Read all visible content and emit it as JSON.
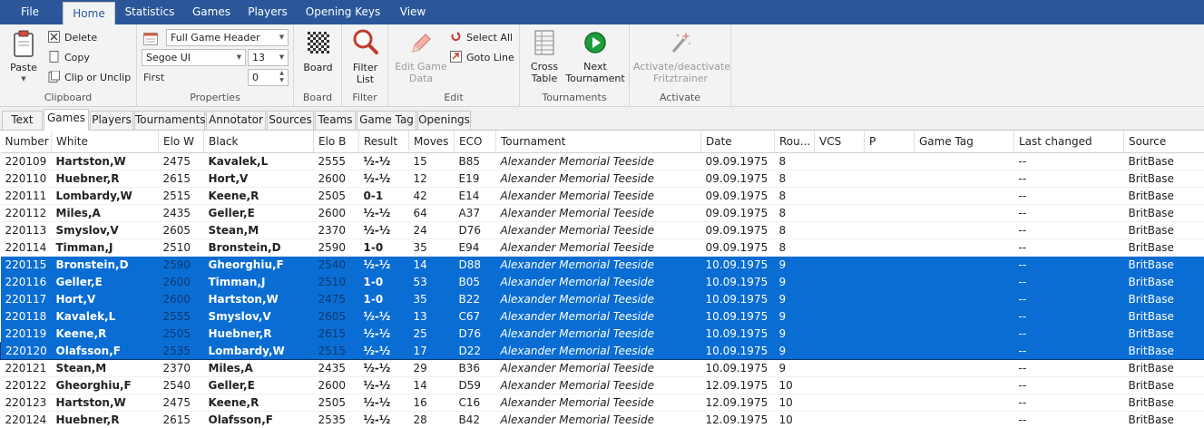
{
  "menu": {
    "file": "File",
    "home": "Home",
    "statistics": "Statistics",
    "games": "Games",
    "players": "Players",
    "opening_keys": "Opening Keys",
    "view": "View"
  },
  "ribbon": {
    "clipboard": {
      "label": "Clipboard",
      "paste": "Paste",
      "delete": "Delete",
      "copy": "Copy",
      "clip_or_unclip": "Clip or Unclip"
    },
    "properties": {
      "label": "Properties",
      "header_format": "Full Game Header",
      "font_family": "Segoe UI",
      "font_size": "13",
      "first_label": "First",
      "first_value": "0"
    },
    "board": {
      "label": "Board",
      "board_button": "Board"
    },
    "filter": {
      "label": "Filter",
      "filter_list_line1": "Filter",
      "filter_list_line2": "List"
    },
    "edit": {
      "label": "Edit",
      "edit_game_data_line1": "Edit Game",
      "edit_game_data_line2": "Data",
      "select_all": "Select All",
      "goto_line": "Goto Line"
    },
    "tournaments": {
      "label": "Tournaments",
      "cross_table_line1": "Cross",
      "cross_table_line2": "Table",
      "next_tournament_line1": "Next",
      "next_tournament_line2": "Tournament"
    },
    "activate": {
      "label": "Activate",
      "fritztrainer_line1": "Activate/deactivate",
      "fritztrainer_line2": "Fritztrainer"
    }
  },
  "tabs": [
    "Text",
    "Games",
    "Players",
    "Tournaments",
    "Annotator",
    "Sources",
    "Teams",
    "Game Tag",
    "Openings"
  ],
  "columns": [
    "Number",
    "White",
    "Elo W",
    "Black",
    "Elo B",
    "Result",
    "Moves",
    "ECO",
    "Tournament",
    "Date",
    "Rou...",
    "VCS",
    "P",
    "Game Tag",
    "Last changed",
    "Source"
  ],
  "rows": [
    [
      "220109",
      "Hartston,W",
      "2475",
      "Kavalek,L",
      "2555",
      "½-½",
      "15",
      "B85",
      "Alexander Memorial Teeside",
      "09.09.1975",
      "8",
      "",
      "",
      "",
      "--",
      "BritBase"
    ],
    [
      "220110",
      "Huebner,R",
      "2615",
      "Hort,V",
      "2600",
      "½-½",
      "12",
      "E19",
      "Alexander Memorial Teeside",
      "09.09.1975",
      "8",
      "",
      "",
      "",
      "--",
      "BritBase"
    ],
    [
      "220111",
      "Lombardy,W",
      "2515",
      "Keene,R",
      "2505",
      "0-1",
      "42",
      "E14",
      "Alexander Memorial Teeside",
      "09.09.1975",
      "8",
      "",
      "",
      "",
      "--",
      "BritBase"
    ],
    [
      "220112",
      "Miles,A",
      "2435",
      "Geller,E",
      "2600",
      "½-½",
      "64",
      "A37",
      "Alexander Memorial Teeside",
      "09.09.1975",
      "8",
      "",
      "",
      "",
      "--",
      "BritBase"
    ],
    [
      "220113",
      "Smyslov,V",
      "2605",
      "Stean,M",
      "2370",
      "½-½",
      "24",
      "D76",
      "Alexander Memorial Teeside",
      "09.09.1975",
      "8",
      "",
      "",
      "",
      "--",
      "BritBase"
    ],
    [
      "220114",
      "Timman,J",
      "2510",
      "Bronstein,D",
      "2590",
      "1-0",
      "35",
      "E94",
      "Alexander Memorial Teeside",
      "09.09.1975",
      "8",
      "",
      "",
      "",
      "--",
      "BritBase"
    ],
    [
      "220115",
      "Bronstein,D",
      "2590",
      "Gheorghiu,F",
      "2540",
      "½-½",
      "14",
      "D88",
      "Alexander Memorial Teeside",
      "10.09.1975",
      "9",
      "",
      "",
      "",
      "--",
      "BritBase"
    ],
    [
      "220116",
      "Geller,E",
      "2600",
      "Timman,J",
      "2510",
      "1-0",
      "53",
      "B05",
      "Alexander Memorial Teeside",
      "10.09.1975",
      "9",
      "",
      "",
      "",
      "--",
      "BritBase"
    ],
    [
      "220117",
      "Hort,V",
      "2600",
      "Hartston,W",
      "2475",
      "1-0",
      "35",
      "B22",
      "Alexander Memorial Teeside",
      "10.09.1975",
      "9",
      "",
      "",
      "",
      "--",
      "BritBase"
    ],
    [
      "220118",
      "Kavalek,L",
      "2555",
      "Smyslov,V",
      "2605",
      "½-½",
      "13",
      "C67",
      "Alexander Memorial Teeside",
      "10.09.1975",
      "9",
      "",
      "",
      "",
      "--",
      "BritBase"
    ],
    [
      "220119",
      "Keene,R",
      "2505",
      "Huebner,R",
      "2615",
      "½-½",
      "25",
      "D76",
      "Alexander Memorial Teeside",
      "10.09.1975",
      "9",
      "",
      "",
      "",
      "--",
      "BritBase"
    ],
    [
      "220120",
      "Olafsson,F",
      "2535",
      "Lombardy,W",
      "2515",
      "½-½",
      "17",
      "D22",
      "Alexander Memorial Teeside",
      "10.09.1975",
      "9",
      "",
      "",
      "",
      "--",
      "BritBase"
    ],
    [
      "220121",
      "Stean,M",
      "2370",
      "Miles,A",
      "2435",
      "½-½",
      "29",
      "B36",
      "Alexander Memorial Teeside",
      "10.09.1975",
      "9",
      "",
      "",
      "",
      "--",
      "BritBase"
    ],
    [
      "220122",
      "Gheorghiu,F",
      "2540",
      "Geller,E",
      "2600",
      "½-½",
      "14",
      "D59",
      "Alexander Memorial Teeside",
      "12.09.1975",
      "10",
      "",
      "",
      "",
      "--",
      "BritBase"
    ],
    [
      "220123",
      "Hartston,W",
      "2475",
      "Keene,R",
      "2505",
      "½-½",
      "16",
      "C16",
      "Alexander Memorial Teeside",
      "12.09.1975",
      "10",
      "",
      "",
      "",
      "--",
      "BritBase"
    ],
    [
      "220124",
      "Huebner,R",
      "2615",
      "Olafsson,F",
      "2535",
      "½-½",
      "28",
      "B42",
      "Alexander Memorial Teeside",
      "12.09.1975",
      "10",
      "",
      "",
      "",
      "--",
      "BritBase"
    ]
  ],
  "selected_rows": [
    6,
    7,
    8,
    9,
    10,
    11
  ],
  "current_row": 11,
  "colors": {
    "menubar": "#2b579a",
    "selection": "#0a6dd3",
    "selection_dim_text": "#0b3a70",
    "next_button_green": "#1e9e3a"
  },
  "icons": {
    "paste": "clipboard-icon",
    "delete": "delete-x-icon",
    "copy": "copy-icon",
    "clip": "clip-icon",
    "board": "chessboard-icon",
    "filter": "magnifier-icon",
    "edit": "pencil-icon",
    "select_all": "select-all-icon",
    "goto": "goto-line-icon",
    "cross_table": "cross-table-icon",
    "next_tournament": "play-next-icon",
    "fritztrainer": "magic-wand-icon"
  }
}
